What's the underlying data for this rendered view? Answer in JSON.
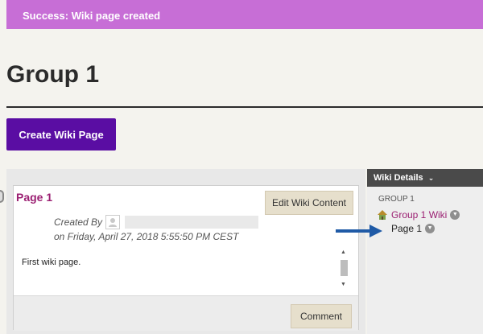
{
  "banner": {
    "text": "Success: Wiki page created"
  },
  "page": {
    "title": "Group 1"
  },
  "actions": {
    "create_label": "Create Wiki Page"
  },
  "wiki_page": {
    "title": "Page 1",
    "edit_label": "Edit Wiki Content",
    "created_by_label": "Created By",
    "created_on": "on Friday, April 27, 2018 5:55:50 PM CEST",
    "body": "First wiki page.",
    "comment_label": "Comment"
  },
  "sidebar": {
    "header": "Wiki Details",
    "group_label": "GROUP 1",
    "wiki_link": "Group 1 Wiki",
    "page_item": "Page 1"
  },
  "colors": {
    "banner": "#c76ed6",
    "primary_button": "#5a0da3",
    "link": "#9b1f72",
    "arrow": "#1f5aa6"
  }
}
